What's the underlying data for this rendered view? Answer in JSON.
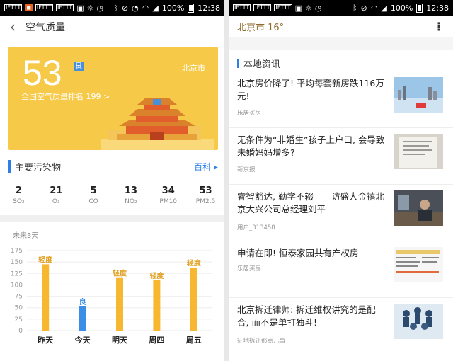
{
  "status_bar": {
    "left_icons": [
      "IFTTT",
      "IFTTT",
      "IFTTT"
    ],
    "battery": "100%",
    "time": "12:38"
  },
  "left": {
    "header": {
      "title": "空气质量"
    },
    "aqi": {
      "value": "53",
      "level": "良",
      "city": "北京市",
      "rank_text": "全国空气质量排名 199 >"
    },
    "pollutants": {
      "title": "主要污染物",
      "link": "百科 ▸",
      "items": [
        {
          "value": "2",
          "name": "SO₂"
        },
        {
          "value": "21",
          "name": "O₃"
        },
        {
          "value": "5",
          "name": "CO"
        },
        {
          "value": "13",
          "name": "NO₂"
        },
        {
          "value": "34",
          "name": "PM10"
        },
        {
          "value": "53",
          "name": "PM2.5"
        }
      ]
    },
    "forecast_label": "未来3天"
  },
  "chart_data": {
    "type": "bar",
    "categories": [
      "昨天",
      "今天",
      "明天",
      "周四",
      "周五"
    ],
    "values": [
      145,
      53,
      115,
      110,
      138
    ],
    "labels": [
      "轻度",
      "良",
      "轻度",
      "轻度",
      "轻度"
    ],
    "colors": [
      "#f7b731",
      "#3a8ee6",
      "#f7b731",
      "#f7b731",
      "#f7b731"
    ],
    "yticks": [
      0,
      25,
      50,
      75,
      100,
      125,
      150,
      175
    ],
    "ylim": [
      0,
      175
    ],
    "grid": true
  },
  "right": {
    "header": {
      "title": "北京市 16°"
    },
    "section": "本地资讯",
    "news": [
      {
        "title": "北京房价降了! 平均每套新房跌116万元!",
        "source": "乐居买房"
      },
      {
        "title": "无条件为“非婚生”孩子上户口, 会导致未婚妈妈增多?",
        "source": "新京报"
      },
      {
        "title": "睿智豁达, 勤学不辍——访盛大金禧北京大兴公司总经理刘平",
        "source": "用户_313458"
      },
      {
        "title": "申请在即! 恒泰家园共有产权房",
        "source": "乐居买房"
      },
      {
        "title": "北京拆迁律师: 拆迁维权讲究的是配合, 而不是单打独斗!",
        "source": "征地拆迁那点儿事"
      }
    ]
  }
}
